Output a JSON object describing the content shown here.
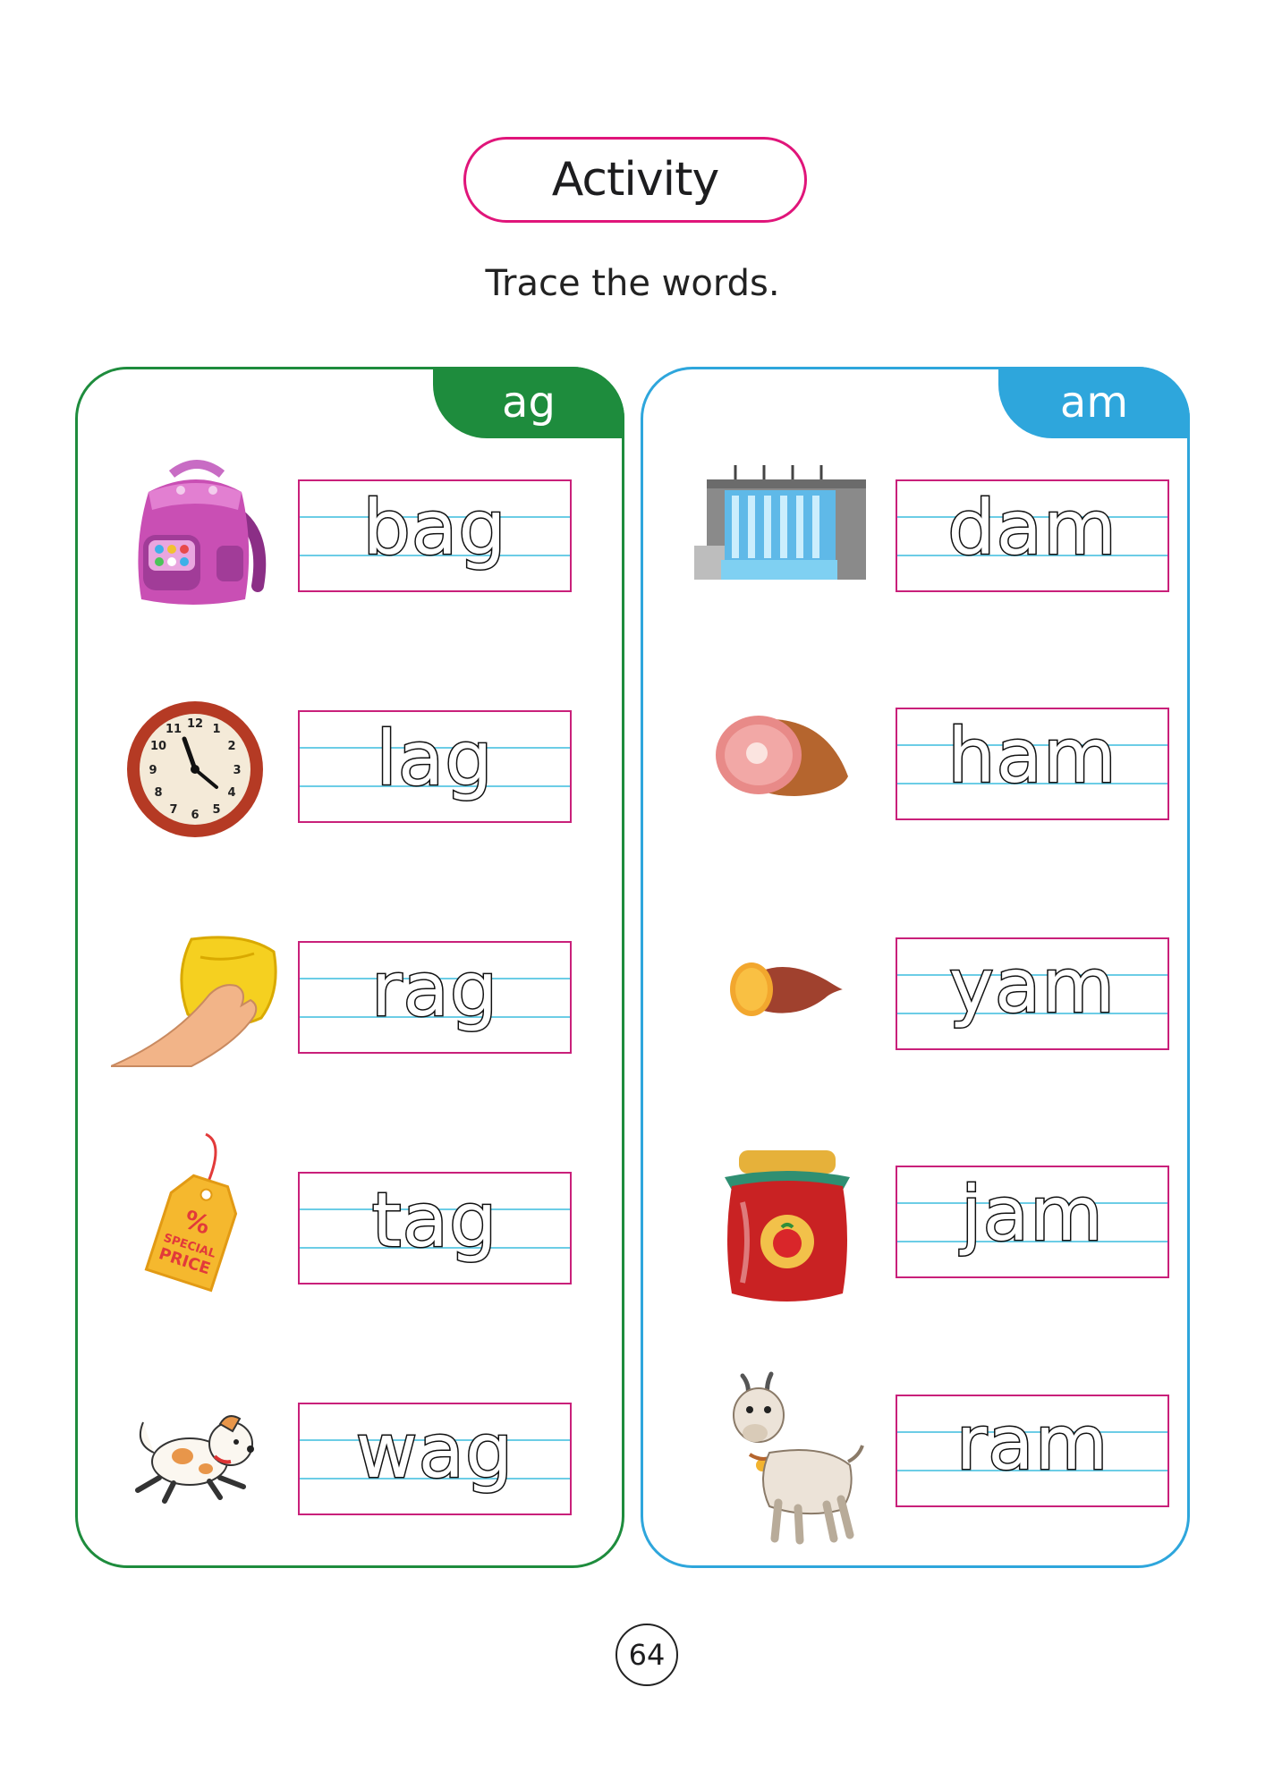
{
  "header": {
    "title": "Activity",
    "instruction": "Trace the words."
  },
  "panels": [
    {
      "tab": "ag",
      "words": [
        "bag",
        "lag",
        "rag",
        "tag",
        "wag"
      ],
      "pictures": [
        "backpack-image",
        "clock-image",
        "cleaning-cloth-image",
        "price-tag-image",
        "running-dog-image"
      ]
    },
    {
      "tab": "am",
      "words": [
        "dam",
        "ham",
        "yam",
        "jam",
        "ram"
      ],
      "pictures": [
        "dam-image",
        "ham-image",
        "yam-image",
        "jam-jar-image",
        "goat-image"
      ]
    }
  ],
  "clock": {
    "numbers": [
      "12",
      "1",
      "2",
      "3",
      "4",
      "5",
      "6",
      "7",
      "8",
      "9",
      "10",
      "11"
    ]
  },
  "price_tag": {
    "symbol": "%",
    "line1": "SPECIAL",
    "line2": "PRICE"
  },
  "footer": {
    "page_number": "64"
  }
}
